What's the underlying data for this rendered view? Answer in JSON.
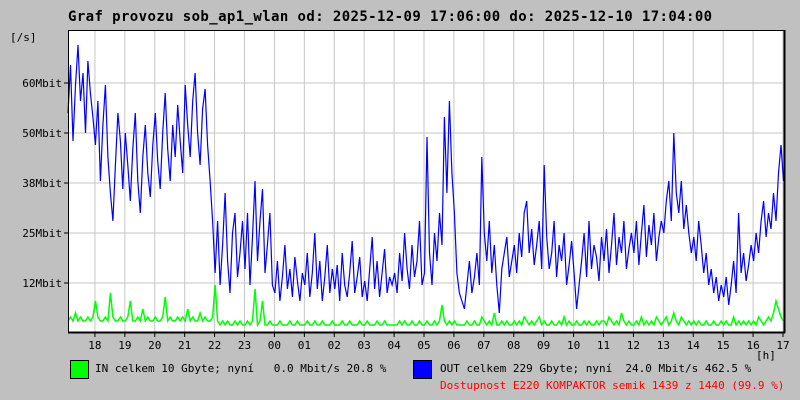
{
  "window": {
    "background": "#c0c0c0",
    "plot_background": "#ffffff",
    "grid_color": "#c6c6c6",
    "frame_color": "#000000"
  },
  "title": "Graf provozu sob_ap1_wlan od: 2025-12-09 17:06:00 do: 2025-12-10 17:04:00",
  "y_axis_unit": "[/s]",
  "x_axis_unit": "[h]",
  "legend": {
    "in_label": "IN celkem 10 Gbyte; nyní   0.0 Mbit/s 20.8 %",
    "out_label": "OUT celkem 229 Gbyte; nyní  24.0 Mbit/s 462.5 %",
    "availability": "Dostupnost E220 KOMPAKTOR semik 1439 z 1440 (99.9 %)",
    "in_color": "#00ff00",
    "out_color": "#0000ff",
    "availability_color": "#ff0000"
  },
  "chart_data": {
    "type": "line",
    "title": "Graf provozu sob_ap1_wlan od: 2025-12-09 17:06:00 do: 2025-12-10 17:04:00",
    "xlabel": "[h]",
    "ylabel": "[/s]",
    "grid": true,
    "ylim": [
      0,
      75.75
    ],
    "x_total_min": 1438,
    "sample_interval_min": 5,
    "x_ticks_start_min": 54,
    "x_ticks_interval_min": 60,
    "x_tick_labels": [
      "18",
      "19",
      "20",
      "21",
      "22",
      "23",
      "00",
      "01",
      "02",
      "03",
      "04",
      "05",
      "06",
      "07",
      "08",
      "09",
      "10",
      "11",
      "12",
      "13",
      "14",
      "15",
      "16",
      "17"
    ],
    "y_ticks": [
      {
        "label": "12Mbit",
        "value": 12.5
      },
      {
        "label": "25Mbit",
        "value": 25
      },
      {
        "label": "38Mbit",
        "value": 37.5
      },
      {
        "label": "50Mbit",
        "value": 50
      },
      {
        "label": "60Mbit",
        "value": 62.5
      }
    ],
    "series": [
      {
        "name": "OUT (Mbit/s)",
        "color": "#0000ff",
        "values": [
          55,
          67,
          48,
          62,
          72,
          58,
          65,
          50,
          68,
          60,
          54,
          47,
          58,
          38,
          52,
          62,
          44,
          35,
          28,
          42,
          55,
          48,
          36,
          50,
          42,
          33,
          46,
          55,
          38,
          30,
          44,
          52,
          40,
          34,
          47,
          55,
          43,
          36,
          50,
          60,
          46,
          38,
          52,
          44,
          57,
          48,
          40,
          62,
          52,
          44,
          58,
          65,
          50,
          42,
          56,
          61,
          47,
          38,
          28,
          15,
          28,
          12,
          22,
          35,
          18,
          10,
          25,
          30,
          14,
          20,
          28,
          16,
          30,
          12,
          24,
          38,
          18,
          28,
          36,
          15,
          22,
          30,
          12,
          10,
          18,
          8,
          14,
          22,
          11,
          16,
          9,
          19,
          13,
          8,
          15,
          12,
          20,
          9,
          15,
          25,
          11,
          18,
          8,
          14,
          22,
          10,
          16,
          11,
          17,
          8,
          20,
          12,
          9,
          15,
          23,
          10,
          14,
          19,
          9,
          13,
          8,
          16,
          24,
          11,
          18,
          9,
          15,
          21,
          10,
          14,
          12,
          15,
          10,
          20,
          13,
          25,
          16,
          11,
          22,
          14,
          18,
          28,
          12,
          15,
          49,
          20,
          12,
          25,
          18,
          30,
          22,
          54,
          35,
          58,
          40,
          30,
          15,
          10,
          8,
          6,
          12,
          18,
          10,
          14,
          20,
          12,
          44,
          25,
          18,
          28,
          15,
          22,
          12,
          5,
          16,
          20,
          24,
          14,
          18,
          22,
          15,
          25,
          19,
          30,
          33,
          20,
          26,
          17,
          22,
          28,
          16,
          42,
          24,
          16,
          20,
          28,
          14,
          22,
          18,
          25,
          12,
          17,
          23,
          15,
          6,
          12,
          18,
          25,
          14,
          28,
          16,
          22,
          19,
          13,
          24,
          18,
          26,
          15,
          22,
          30,
          17,
          24,
          20,
          28,
          16,
          21,
          25,
          20,
          28,
          17,
          25,
          32,
          19,
          27,
          22,
          30,
          18,
          24,
          28,
          25,
          33,
          38,
          28,
          50,
          35,
          30,
          38,
          26,
          32,
          25,
          20,
          24,
          18,
          28,
          22,
          15,
          20,
          12,
          16,
          10,
          14,
          8,
          12,
          9,
          14,
          7,
          12,
          18,
          10,
          30,
          15,
          20,
          13,
          17,
          22,
          18,
          25,
          20,
          28,
          33,
          24,
          30,
          26,
          35,
          28,
          40,
          47,
          38
        ]
      },
      {
        "name": "IN (Mbit/s)",
        "color": "#00ff00",
        "values": [
          3,
          4,
          3,
          5,
          3,
          4,
          3,
          3,
          4,
          3,
          4,
          8,
          4,
          3,
          3,
          4,
          3,
          10,
          4,
          3,
          3,
          4,
          3,
          3,
          4,
          8,
          3,
          3,
          4,
          3,
          6,
          3,
          4,
          3,
          3,
          4,
          3,
          3,
          4,
          9,
          3,
          4,
          3,
          3,
          4,
          3,
          4,
          3,
          6,
          3,
          4,
          3,
          3,
          5,
          3,
          4,
          3,
          3,
          4,
          12,
          3,
          2,
          3,
          2,
          3,
          2,
          2,
          3,
          2,
          3,
          2,
          2,
          3,
          2,
          3,
          11,
          2,
          3,
          8,
          2,
          2,
          3,
          2,
          2,
          2,
          3,
          2,
          2,
          2,
          3,
          2,
          2,
          3,
          2,
          2,
          2,
          3,
          2,
          2,
          3,
          2,
          2,
          3,
          2,
          2,
          2,
          3,
          2,
          2,
          2,
          3,
          2,
          2,
          3,
          2,
          2,
          2,
          3,
          2,
          2,
          3,
          2,
          2,
          2,
          3,
          2,
          2,
          3,
          2,
          2,
          2,
          2,
          2,
          3,
          2,
          3,
          2,
          2,
          3,
          2,
          2,
          3,
          2,
          2,
          3,
          2,
          2,
          3,
          2,
          3,
          7,
          3,
          2,
          3,
          2,
          3,
          2,
          2,
          2,
          2,
          3,
          2,
          2,
          3,
          2,
          2,
          4,
          3,
          2,
          3,
          2,
          5,
          2,
          2,
          3,
          2,
          3,
          2,
          2,
          3,
          2,
          3,
          2,
          4,
          3,
          2,
          3,
          2,
          3,
          4,
          2,
          3,
          2,
          2,
          3,
          2,
          2,
          3,
          2,
          4,
          2,
          3,
          2,
          2,
          3,
          2,
          2,
          3,
          2,
          3,
          2,
          2,
          3,
          2,
          3,
          3,
          2,
          4,
          3,
          2,
          3,
          2,
          5,
          3,
          2,
          3,
          2,
          2,
          3,
          2,
          4,
          2,
          3,
          2,
          3,
          2,
          4,
          3,
          2,
          3,
          4,
          2,
          3,
          5,
          3,
          2,
          4,
          3,
          2,
          3,
          2,
          3,
          2,
          3,
          2,
          2,
          3,
          2,
          2,
          3,
          2,
          2,
          3,
          2,
          3,
          2,
          2,
          4,
          2,
          3,
          2,
          3,
          2,
          3,
          2,
          3,
          2,
          4,
          3,
          2,
          3,
          4,
          3,
          5,
          8,
          6,
          4,
          3
        ]
      }
    ]
  }
}
